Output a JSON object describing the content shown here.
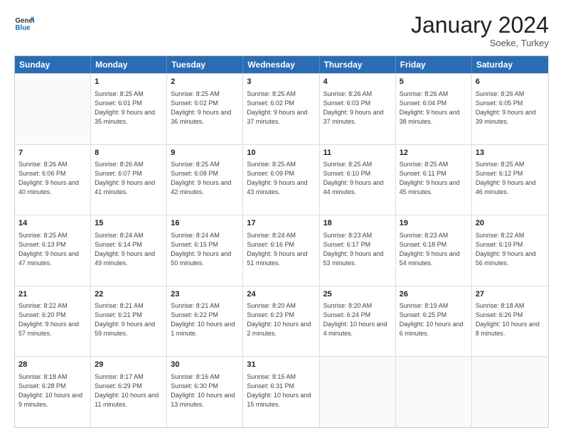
{
  "header": {
    "logo_line1": "General",
    "logo_line2": "Blue",
    "month": "January 2024",
    "location": "Soeke, Turkey"
  },
  "days_of_week": [
    "Sunday",
    "Monday",
    "Tuesday",
    "Wednesday",
    "Thursday",
    "Friday",
    "Saturday"
  ],
  "weeks": [
    [
      {
        "day": "",
        "sunrise": "",
        "sunset": "",
        "daylight": ""
      },
      {
        "day": "1",
        "sunrise": "Sunrise: 8:25 AM",
        "sunset": "Sunset: 6:01 PM",
        "daylight": "Daylight: 9 hours and 35 minutes."
      },
      {
        "day": "2",
        "sunrise": "Sunrise: 8:25 AM",
        "sunset": "Sunset: 6:02 PM",
        "daylight": "Daylight: 9 hours and 36 minutes."
      },
      {
        "day": "3",
        "sunrise": "Sunrise: 8:25 AM",
        "sunset": "Sunset: 6:02 PM",
        "daylight": "Daylight: 9 hours and 37 minutes."
      },
      {
        "day": "4",
        "sunrise": "Sunrise: 8:26 AM",
        "sunset": "Sunset: 6:03 PM",
        "daylight": "Daylight: 9 hours and 37 minutes."
      },
      {
        "day": "5",
        "sunrise": "Sunrise: 8:26 AM",
        "sunset": "Sunset: 6:04 PM",
        "daylight": "Daylight: 9 hours and 38 minutes."
      },
      {
        "day": "6",
        "sunrise": "Sunrise: 8:26 AM",
        "sunset": "Sunset: 6:05 PM",
        "daylight": "Daylight: 9 hours and 39 minutes."
      }
    ],
    [
      {
        "day": "7",
        "sunrise": "Sunrise: 8:26 AM",
        "sunset": "Sunset: 6:06 PM",
        "daylight": "Daylight: 9 hours and 40 minutes."
      },
      {
        "day": "8",
        "sunrise": "Sunrise: 8:26 AM",
        "sunset": "Sunset: 6:07 PM",
        "daylight": "Daylight: 9 hours and 41 minutes."
      },
      {
        "day": "9",
        "sunrise": "Sunrise: 8:25 AM",
        "sunset": "Sunset: 6:08 PM",
        "daylight": "Daylight: 9 hours and 42 minutes."
      },
      {
        "day": "10",
        "sunrise": "Sunrise: 8:25 AM",
        "sunset": "Sunset: 6:09 PM",
        "daylight": "Daylight: 9 hours and 43 minutes."
      },
      {
        "day": "11",
        "sunrise": "Sunrise: 8:25 AM",
        "sunset": "Sunset: 6:10 PM",
        "daylight": "Daylight: 9 hours and 44 minutes."
      },
      {
        "day": "12",
        "sunrise": "Sunrise: 8:25 AM",
        "sunset": "Sunset: 6:11 PM",
        "daylight": "Daylight: 9 hours and 45 minutes."
      },
      {
        "day": "13",
        "sunrise": "Sunrise: 8:25 AM",
        "sunset": "Sunset: 6:12 PM",
        "daylight": "Daylight: 9 hours and 46 minutes."
      }
    ],
    [
      {
        "day": "14",
        "sunrise": "Sunrise: 8:25 AM",
        "sunset": "Sunset: 6:13 PM",
        "daylight": "Daylight: 9 hours and 47 minutes."
      },
      {
        "day": "15",
        "sunrise": "Sunrise: 8:24 AM",
        "sunset": "Sunset: 6:14 PM",
        "daylight": "Daylight: 9 hours and 49 minutes."
      },
      {
        "day": "16",
        "sunrise": "Sunrise: 8:24 AM",
        "sunset": "Sunset: 6:15 PM",
        "daylight": "Daylight: 9 hours and 50 minutes."
      },
      {
        "day": "17",
        "sunrise": "Sunrise: 8:24 AM",
        "sunset": "Sunset: 6:16 PM",
        "daylight": "Daylight: 9 hours and 51 minutes."
      },
      {
        "day": "18",
        "sunrise": "Sunrise: 8:23 AM",
        "sunset": "Sunset: 6:17 PM",
        "daylight": "Daylight: 9 hours and 53 minutes."
      },
      {
        "day": "19",
        "sunrise": "Sunrise: 8:23 AM",
        "sunset": "Sunset: 6:18 PM",
        "daylight": "Daylight: 9 hours and 54 minutes."
      },
      {
        "day": "20",
        "sunrise": "Sunrise: 8:22 AM",
        "sunset": "Sunset: 6:19 PM",
        "daylight": "Daylight: 9 hours and 56 minutes."
      }
    ],
    [
      {
        "day": "21",
        "sunrise": "Sunrise: 8:22 AM",
        "sunset": "Sunset: 6:20 PM",
        "daylight": "Daylight: 9 hours and 57 minutes."
      },
      {
        "day": "22",
        "sunrise": "Sunrise: 8:21 AM",
        "sunset": "Sunset: 6:21 PM",
        "daylight": "Daylight: 9 hours and 59 minutes."
      },
      {
        "day": "23",
        "sunrise": "Sunrise: 8:21 AM",
        "sunset": "Sunset: 6:22 PM",
        "daylight": "Daylight: 10 hours and 1 minute."
      },
      {
        "day": "24",
        "sunrise": "Sunrise: 8:20 AM",
        "sunset": "Sunset: 6:23 PM",
        "daylight": "Daylight: 10 hours and 2 minutes."
      },
      {
        "day": "25",
        "sunrise": "Sunrise: 8:20 AM",
        "sunset": "Sunset: 6:24 PM",
        "daylight": "Daylight: 10 hours and 4 minutes."
      },
      {
        "day": "26",
        "sunrise": "Sunrise: 8:19 AM",
        "sunset": "Sunset: 6:25 PM",
        "daylight": "Daylight: 10 hours and 6 minutes."
      },
      {
        "day": "27",
        "sunrise": "Sunrise: 8:18 AM",
        "sunset": "Sunset: 6:26 PM",
        "daylight": "Daylight: 10 hours and 8 minutes."
      }
    ],
    [
      {
        "day": "28",
        "sunrise": "Sunrise: 8:18 AM",
        "sunset": "Sunset: 6:28 PM",
        "daylight": "Daylight: 10 hours and 9 minutes."
      },
      {
        "day": "29",
        "sunrise": "Sunrise: 8:17 AM",
        "sunset": "Sunset: 6:29 PM",
        "daylight": "Daylight: 10 hours and 11 minutes."
      },
      {
        "day": "30",
        "sunrise": "Sunrise: 8:16 AM",
        "sunset": "Sunset: 6:30 PM",
        "daylight": "Daylight: 10 hours and 13 minutes."
      },
      {
        "day": "31",
        "sunrise": "Sunrise: 8:15 AM",
        "sunset": "Sunset: 6:31 PM",
        "daylight": "Daylight: 10 hours and 15 minutes."
      },
      {
        "day": "",
        "sunrise": "",
        "sunset": "",
        "daylight": ""
      },
      {
        "day": "",
        "sunrise": "",
        "sunset": "",
        "daylight": ""
      },
      {
        "day": "",
        "sunrise": "",
        "sunset": "",
        "daylight": ""
      }
    ]
  ]
}
